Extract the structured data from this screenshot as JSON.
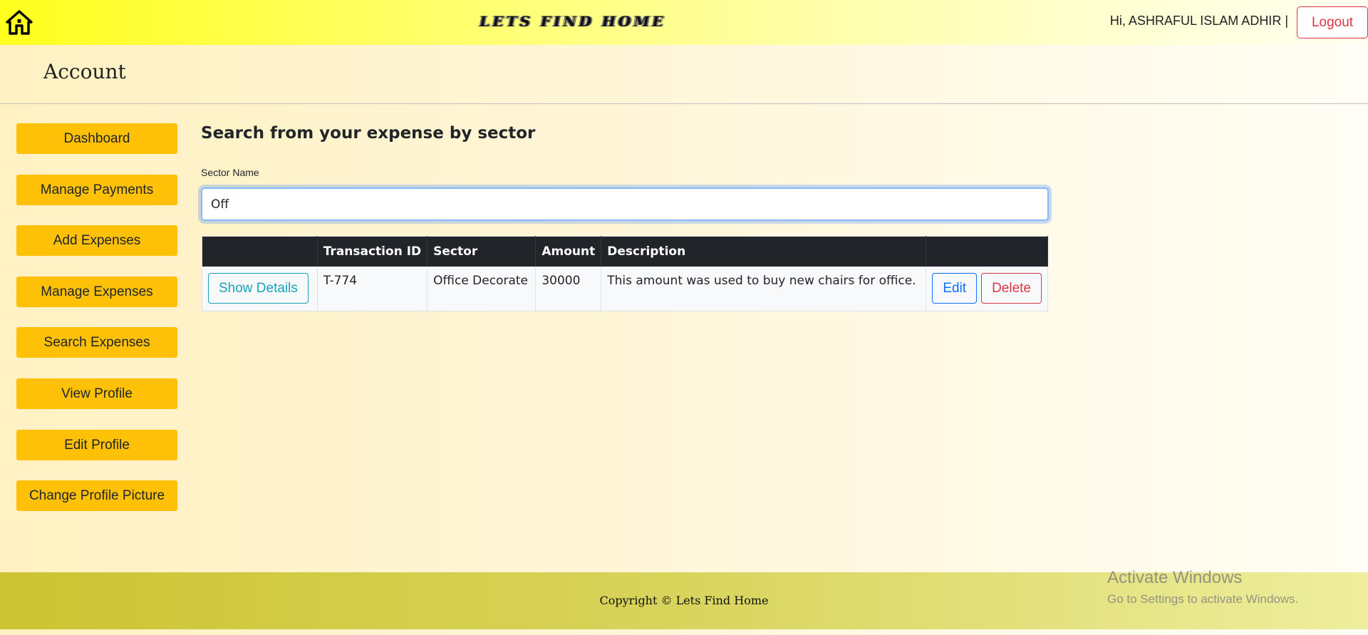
{
  "header": {
    "brand": "LETS FIND HOME",
    "greeting": "Hi, ASHRAFUL ISLAM ADHIR  |",
    "logout_label": "Logout"
  },
  "account": {
    "title": "Account"
  },
  "sidebar": {
    "items": [
      {
        "label": "Dashboard"
      },
      {
        "label": "Manage Payments"
      },
      {
        "label": "Add Expenses"
      },
      {
        "label": "Manage Expenses"
      },
      {
        "label": "Search Expenses"
      },
      {
        "label": "View Profile"
      },
      {
        "label": "Edit Profile"
      },
      {
        "label": "Change Profile Picture"
      }
    ]
  },
  "main": {
    "heading": "Search from your expense by sector",
    "field_label": "Sector Name",
    "search_value": "Off",
    "table": {
      "columns": [
        "",
        "Transaction ID",
        "Sector",
        "Amount",
        "Description",
        ""
      ],
      "rows": [
        {
          "details_label": "Show Details",
          "transaction_id": "T-774",
          "sector": "Office Decorate",
          "amount": "30000",
          "description": "This amount was used to buy new chairs for office.",
          "edit_label": "Edit",
          "delete_label": "Delete"
        }
      ]
    }
  },
  "footer": {
    "text": "Copyright © Lets Find Home"
  },
  "watermark": {
    "title": "Activate Windows",
    "subtitle": "Go to Settings to activate Windows."
  },
  "colors": {
    "accent_button": "#ffc107",
    "table_header": "#212529",
    "danger": "#dc3545",
    "info": "#17a2b8",
    "primary": "#0d6efd"
  },
  "icons": {
    "home": "home-icon"
  }
}
